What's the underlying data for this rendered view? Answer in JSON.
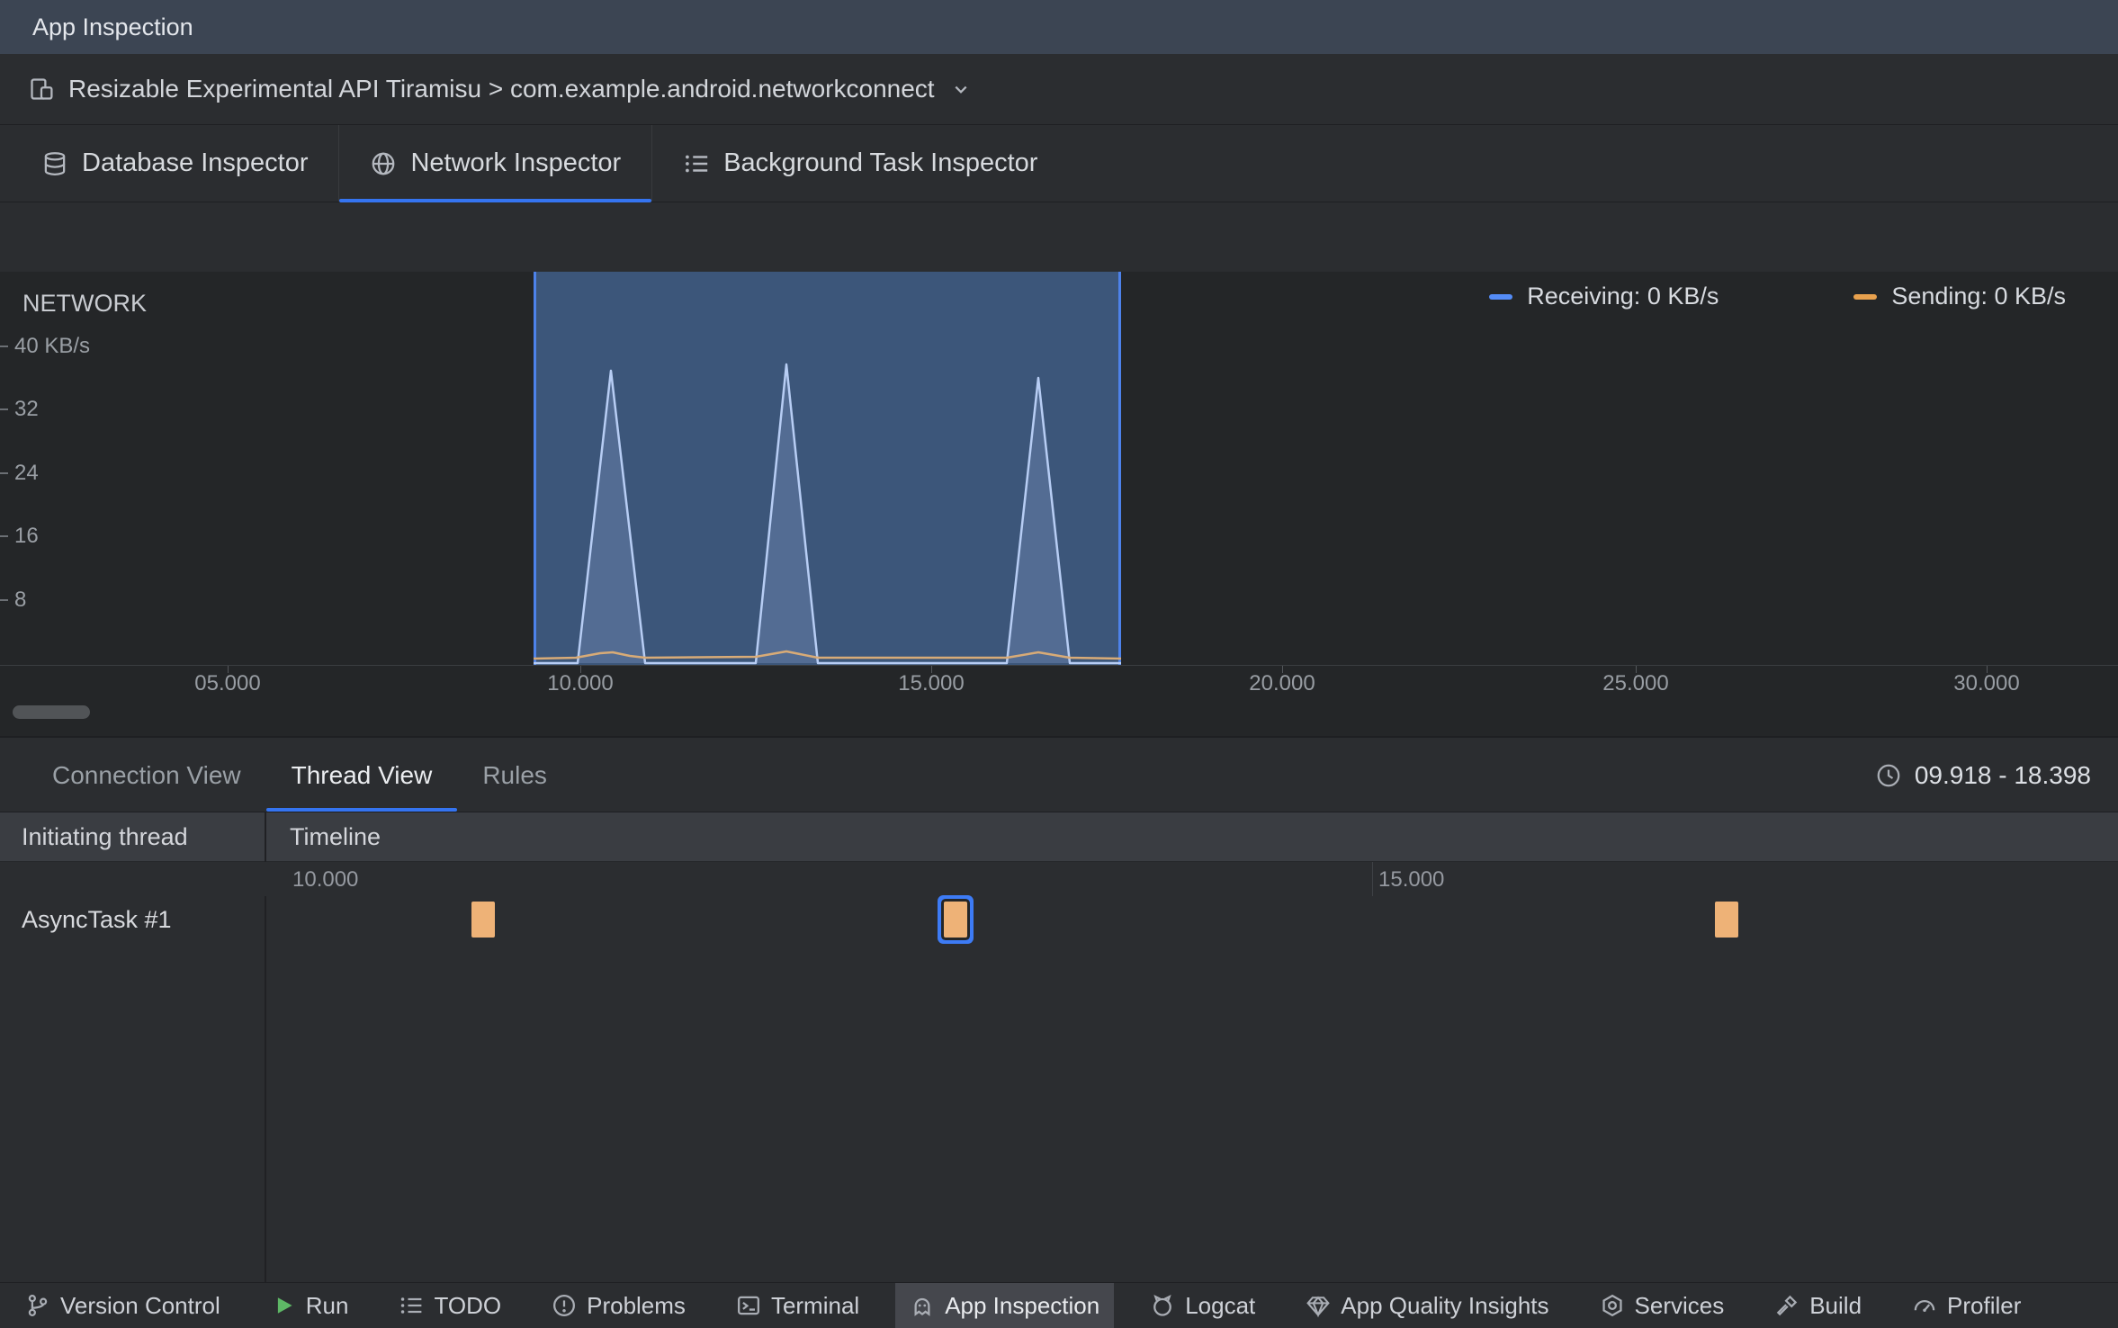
{
  "colors": {
    "accent_blue": "#3574f0",
    "selection_border": "#4d82ea",
    "receiving_blue": "#548cf7",
    "sending_orange": "#e8a14e",
    "event_block_orange": "#eeb277"
  },
  "titlebar": {
    "title": "App Inspection"
  },
  "device_bar": {
    "label": "Resizable Experimental API Tiramisu > com.example.android.networkconnect",
    "device_icon": "device-icon",
    "chevron_icon": "chevron-down-icon"
  },
  "inspector_tabs": [
    {
      "label": "Database Inspector",
      "icon": "database-icon",
      "selected": false
    },
    {
      "label": "Network Inspector",
      "icon": "globe-icon",
      "selected": true
    },
    {
      "label": "Background Task Inspector",
      "icon": "checklist-icon",
      "selected": false
    }
  ],
  "network_chart": {
    "title": "NETWORK",
    "legend": [
      {
        "label": "Receiving: 0 KB/s",
        "color": "#548cf7"
      },
      {
        "label": "Sending: 0 KB/s",
        "color": "#e8a14e"
      }
    ],
    "y_ticks": [
      "40 KB/s",
      "32",
      "24",
      "16",
      "8"
    ],
    "x_ticks": [
      "05.000",
      "10.000",
      "15.000",
      "20.000",
      "25.000",
      "30.000"
    ]
  },
  "chart_data": {
    "type": "area",
    "title": "NETWORK",
    "ylabel": "KB/s",
    "ylim": [
      0,
      48
    ],
    "y_ticks_kbps": [
      8,
      16,
      24,
      32,
      40
    ],
    "x_ticks_seconds": [
      5,
      10,
      15,
      20,
      25,
      30
    ],
    "selection_range_seconds": [
      9.918,
      18.398
    ],
    "series": [
      {
        "name": "Receiving",
        "current_label": "Receiving: 0 KB/s",
        "current_kbps": 0,
        "color": "#548cf7",
        "spikes": [
          {
            "t_seconds": 10.5,
            "peak_kbps": 37
          },
          {
            "t_seconds": 13.0,
            "peak_kbps": 37.5
          },
          {
            "t_seconds": 16.6,
            "peak_kbps": 36
          }
        ]
      },
      {
        "name": "Sending",
        "current_label": "Sending: 0 KB/s",
        "current_kbps": 0,
        "color": "#e8a14e",
        "spikes": [
          {
            "t_seconds": 10.5,
            "peak_kbps": 1
          },
          {
            "t_seconds": 13.0,
            "peak_kbps": 1
          },
          {
            "t_seconds": 16.6,
            "peak_kbps": 1
          }
        ]
      }
    ]
  },
  "detail_panel": {
    "tabs": [
      {
        "label": "Connection View",
        "selected": false
      },
      {
        "label": "Thread View",
        "selected": true
      },
      {
        "label": "Rules",
        "selected": false
      }
    ],
    "time_range": "09.918 - 18.398",
    "columns": [
      "Initiating thread",
      "Timeline"
    ],
    "ruler_ticks": [
      "10.000",
      "15.000"
    ],
    "rows": [
      {
        "thread": "AsyncTask #1",
        "events": [
          {
            "t_seconds": 10.9,
            "selected": false
          },
          {
            "t_seconds": 13.1,
            "selected": true
          },
          {
            "t_seconds": 16.7,
            "selected": false
          }
        ]
      }
    ]
  },
  "bottom_bar": [
    {
      "label": "Version Control",
      "icon": "branch-icon",
      "selected": false
    },
    {
      "label": "Run",
      "icon": "run-icon",
      "selected": false
    },
    {
      "label": "TODO",
      "icon": "todo-icon",
      "selected": false
    },
    {
      "label": "Problems",
      "icon": "problems-icon",
      "selected": false
    },
    {
      "label": "Terminal",
      "icon": "terminal-icon",
      "selected": false
    },
    {
      "label": "App Inspection",
      "icon": "app-inspection-icon",
      "selected": true
    },
    {
      "label": "Logcat",
      "icon": "logcat-icon",
      "selected": false
    },
    {
      "label": "App Quality Insights",
      "icon": "gem-icon",
      "selected": false
    },
    {
      "label": "Services",
      "icon": "services-icon",
      "selected": false
    },
    {
      "label": "Build",
      "icon": "build-icon",
      "selected": false
    },
    {
      "label": "Profiler",
      "icon": "profiler-icon",
      "selected": false
    }
  ]
}
